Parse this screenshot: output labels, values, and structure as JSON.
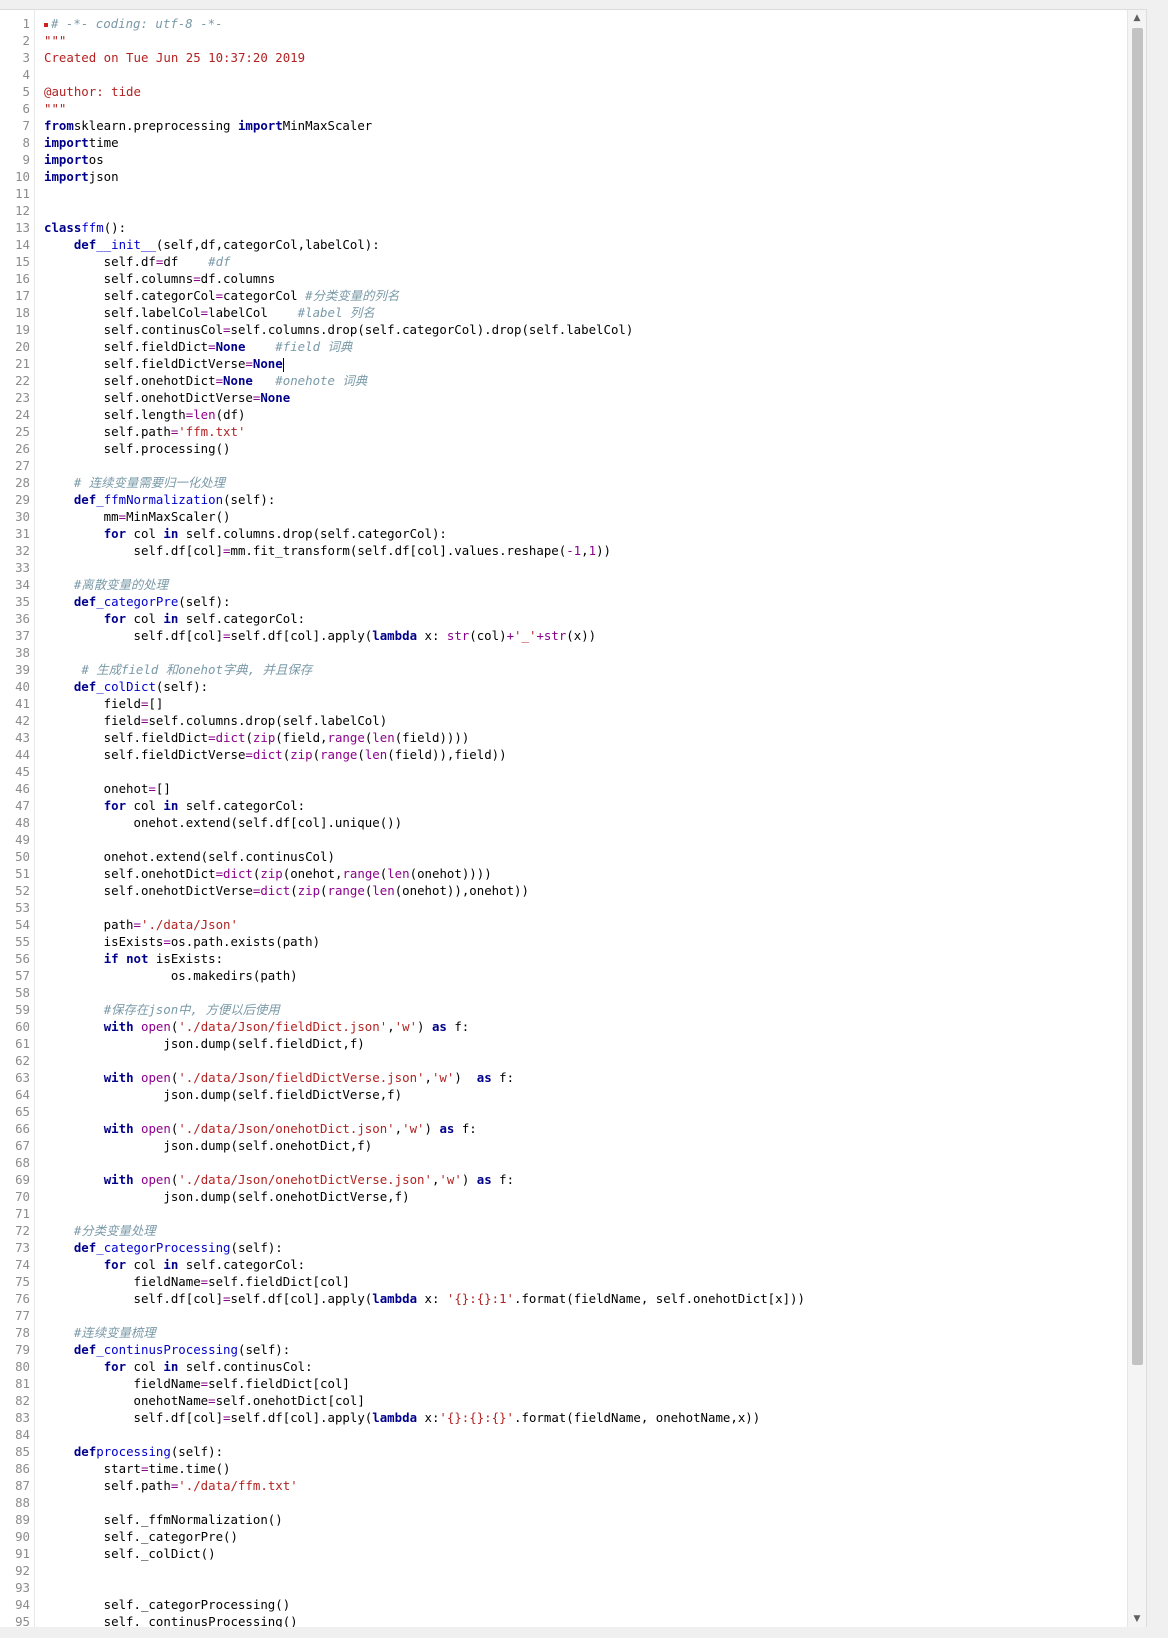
{
  "editor": {
    "language": "python",
    "cursor_line": 21,
    "lines": [
      [
        [
          "marker",
          ""
        ],
        [
          "com",
          "# -*- coding: utf-8 -*-"
        ]
      ],
      [
        [
          "str",
          "\"\"\""
        ]
      ],
      [
        [
          "str",
          "Created on Tue Jun 25 10:37:20 2019"
        ]
      ],
      [],
      [
        [
          "str",
          "@author: tide"
        ]
      ],
      [
        [
          "str",
          "\"\"\""
        ]
      ],
      [
        [
          "kw",
          "from"
        ],
        [
          "",
          "sklearn.preprocessing "
        ],
        [
          "kw",
          "import"
        ],
        [
          "",
          "MinMaxScaler"
        ]
      ],
      [
        [
          "kw",
          "import"
        ],
        [
          "",
          "time"
        ]
      ],
      [
        [
          "kw",
          "import"
        ],
        [
          "",
          "os"
        ]
      ],
      [
        [
          "kw",
          "import"
        ],
        [
          "",
          "json"
        ]
      ],
      [],
      [],
      [
        [
          "kw",
          "class"
        ],
        [
          "fn",
          "ffm"
        ],
        [
          "",
          "():"
        ]
      ],
      [
        [
          "",
          "    "
        ],
        [
          "kw",
          "def"
        ],
        [
          "fn",
          "__init__"
        ],
        [
          "",
          "(self,df,categorCol,labelCol):"
        ]
      ],
      [
        [
          "",
          "        self.df"
        ],
        [
          "op",
          "="
        ],
        [
          "",
          "df    "
        ],
        [
          "com",
          "#df"
        ]
      ],
      [
        [
          "",
          "        self.columns"
        ],
        [
          "op",
          "="
        ],
        [
          "",
          "df.columns"
        ]
      ],
      [
        [
          "",
          "        self.categorCol"
        ],
        [
          "op",
          "="
        ],
        [
          "",
          "categorCol "
        ],
        [
          "com",
          "#分类变量的列名"
        ]
      ],
      [
        [
          "",
          "        self.labelCol"
        ],
        [
          "op",
          "="
        ],
        [
          "",
          "labelCol    "
        ],
        [
          "com",
          "#label 列名"
        ]
      ],
      [
        [
          "",
          "        self.continusCol"
        ],
        [
          "op",
          "="
        ],
        [
          "",
          "self.columns.drop(self.categorCol).drop(self.labelCol)"
        ]
      ],
      [
        [
          "",
          "        self.fieldDict"
        ],
        [
          "op",
          "="
        ],
        [
          "kw",
          "None"
        ],
        [
          "",
          "    "
        ],
        [
          "com",
          "#field 词典"
        ]
      ],
      [
        [
          "",
          "        self.fieldDictVerse"
        ],
        [
          "op",
          "="
        ],
        [
          "kw",
          "None"
        ],
        [
          "caret",
          ""
        ]
      ],
      [
        [
          "",
          "        self.onehotDict"
        ],
        [
          "op",
          "="
        ],
        [
          "kw",
          "None"
        ],
        [
          "",
          "   "
        ],
        [
          "com",
          "#onehote 词典"
        ]
      ],
      [
        [
          "",
          "        self.onehotDictVerse"
        ],
        [
          "op",
          "="
        ],
        [
          "kw",
          "None"
        ]
      ],
      [
        [
          "",
          "        self.length"
        ],
        [
          "op",
          "="
        ],
        [
          "bi",
          "len"
        ],
        [
          "",
          "(df)"
        ]
      ],
      [
        [
          "",
          "        self.path"
        ],
        [
          "op",
          "="
        ],
        [
          "str",
          "'ffm.txt'"
        ]
      ],
      [
        [
          "",
          "        self.processing()"
        ]
      ],
      [],
      [
        [
          "",
          "    "
        ],
        [
          "com",
          "# 连续变量需要归一化处理"
        ]
      ],
      [
        [
          "",
          "    "
        ],
        [
          "kw",
          "def"
        ],
        [
          "fn",
          "_ffmNormalization"
        ],
        [
          "",
          "(self):"
        ]
      ],
      [
        [
          "",
          "        mm"
        ],
        [
          "op",
          "="
        ],
        [
          "",
          "MinMaxScaler()"
        ]
      ],
      [
        [
          "",
          "        "
        ],
        [
          "kw",
          "for"
        ],
        [
          "",
          " col "
        ],
        [
          "kw",
          "in"
        ],
        [
          "",
          " self.columns.drop(self.categorCol):"
        ]
      ],
      [
        [
          "",
          "            self.df[col]"
        ],
        [
          "op",
          "="
        ],
        [
          "",
          "mm.fit_transform(self.df[col].values.reshape("
        ],
        [
          "num",
          "-1"
        ],
        [
          "",
          ","
        ],
        [
          "num",
          "1"
        ],
        [
          "",
          "))"
        ]
      ],
      [],
      [
        [
          "",
          "    "
        ],
        [
          "com",
          "#离散变量的处理"
        ]
      ],
      [
        [
          "",
          "    "
        ],
        [
          "kw",
          "def"
        ],
        [
          "fn",
          "_categorPre"
        ],
        [
          "",
          "(self):"
        ]
      ],
      [
        [
          "",
          "        "
        ],
        [
          "kw",
          "for"
        ],
        [
          "",
          " col "
        ],
        [
          "kw",
          "in"
        ],
        [
          "",
          " self.categorCol:"
        ]
      ],
      [
        [
          "",
          "            self.df[col]"
        ],
        [
          "op",
          "="
        ],
        [
          "",
          "self.df[col].apply("
        ],
        [
          "kw",
          "lambda"
        ],
        [
          "",
          " x: "
        ],
        [
          "bi",
          "str"
        ],
        [
          "",
          "(col)"
        ],
        [
          "op",
          "+"
        ],
        [
          "str",
          "'_'"
        ],
        [
          "op",
          "+"
        ],
        [
          "bi",
          "str"
        ],
        [
          "",
          "(x))"
        ]
      ],
      [],
      [
        [
          "",
          "     "
        ],
        [
          "com",
          "# 生成field 和onehot字典, 并且保存"
        ]
      ],
      [
        [
          "",
          "    "
        ],
        [
          "kw",
          "def"
        ],
        [
          "fn",
          "_colDict"
        ],
        [
          "",
          "(self):"
        ]
      ],
      [
        [
          "",
          "        field"
        ],
        [
          "op",
          "="
        ],
        [
          "",
          "[]"
        ]
      ],
      [
        [
          "",
          "        field"
        ],
        [
          "op",
          "="
        ],
        [
          "",
          "self.columns.drop(self.labelCol)"
        ]
      ],
      [
        [
          "",
          "        self.fieldDict"
        ],
        [
          "op",
          "="
        ],
        [
          "bi",
          "dict"
        ],
        [
          "",
          "("
        ],
        [
          "bi",
          "zip"
        ],
        [
          "",
          "(field,"
        ],
        [
          "bi",
          "range"
        ],
        [
          "",
          "("
        ],
        [
          "bi",
          "len"
        ],
        [
          "",
          "(field))))"
        ]
      ],
      [
        [
          "",
          "        self.fieldDictVerse"
        ],
        [
          "op",
          "="
        ],
        [
          "bi",
          "dict"
        ],
        [
          "",
          "("
        ],
        [
          "bi",
          "zip"
        ],
        [
          "",
          "("
        ],
        [
          "bi",
          "range"
        ],
        [
          "",
          "("
        ],
        [
          "bi",
          "len"
        ],
        [
          "",
          "(field)),field))"
        ]
      ],
      [],
      [
        [
          "",
          "        onehot"
        ],
        [
          "op",
          "="
        ],
        [
          "",
          "[]"
        ]
      ],
      [
        [
          "",
          "        "
        ],
        [
          "kw",
          "for"
        ],
        [
          "",
          " col "
        ],
        [
          "kw",
          "in"
        ],
        [
          "",
          " self.categorCol:"
        ]
      ],
      [
        [
          "",
          "            onehot.extend(self.df[col].unique())"
        ]
      ],
      [],
      [
        [
          "",
          "        onehot.extend(self.continusCol)"
        ]
      ],
      [
        [
          "",
          "        self.onehotDict"
        ],
        [
          "op",
          "="
        ],
        [
          "bi",
          "dict"
        ],
        [
          "",
          "("
        ],
        [
          "bi",
          "zip"
        ],
        [
          "",
          "(onehot,"
        ],
        [
          "bi",
          "range"
        ],
        [
          "",
          "("
        ],
        [
          "bi",
          "len"
        ],
        [
          "",
          "(onehot))))"
        ]
      ],
      [
        [
          "",
          "        self.onehotDictVerse"
        ],
        [
          "op",
          "="
        ],
        [
          "bi",
          "dict"
        ],
        [
          "",
          "("
        ],
        [
          "bi",
          "zip"
        ],
        [
          "",
          "("
        ],
        [
          "bi",
          "range"
        ],
        [
          "",
          "("
        ],
        [
          "bi",
          "len"
        ],
        [
          "",
          "(onehot)),onehot))"
        ]
      ],
      [],
      [
        [
          "",
          "        path"
        ],
        [
          "op",
          "="
        ],
        [
          "str",
          "'./data/Json'"
        ]
      ],
      [
        [
          "",
          "        isExists"
        ],
        [
          "op",
          "="
        ],
        [
          "",
          "os.path.exists(path)"
        ]
      ],
      [
        [
          "",
          "        "
        ],
        [
          "kw",
          "if not"
        ],
        [
          "",
          " isExists:"
        ]
      ],
      [
        [
          "",
          "                 os.makedirs(path)"
        ]
      ],
      [],
      [
        [
          "",
          "        "
        ],
        [
          "com",
          "#保存在json中, 方便以后使用"
        ]
      ],
      [
        [
          "",
          "        "
        ],
        [
          "kw",
          "with"
        ],
        [
          "",
          " "
        ],
        [
          "bi",
          "open"
        ],
        [
          "",
          "("
        ],
        [
          "str",
          "'./data/Json/fieldDict.json'"
        ],
        [
          "",
          ","
        ],
        [
          "str",
          "'w'"
        ],
        [
          "",
          ") "
        ],
        [
          "kw",
          "as"
        ],
        [
          "",
          " f:"
        ]
      ],
      [
        [
          "",
          "                json.dump(self.fieldDict,f)"
        ]
      ],
      [],
      [
        [
          "",
          "        "
        ],
        [
          "kw",
          "with"
        ],
        [
          "",
          " "
        ],
        [
          "bi",
          "open"
        ],
        [
          "",
          "("
        ],
        [
          "str",
          "'./data/Json/fieldDictVerse.json'"
        ],
        [
          "",
          ","
        ],
        [
          "str",
          "'w'"
        ],
        [
          "",
          ")  "
        ],
        [
          "kw",
          "as"
        ],
        [
          "",
          " f:"
        ]
      ],
      [
        [
          "",
          "                json.dump(self.fieldDictVerse,f)"
        ]
      ],
      [],
      [
        [
          "",
          "        "
        ],
        [
          "kw",
          "with"
        ],
        [
          "",
          " "
        ],
        [
          "bi",
          "open"
        ],
        [
          "",
          "("
        ],
        [
          "str",
          "'./data/Json/onehotDict.json'"
        ],
        [
          "",
          ","
        ],
        [
          "str",
          "'w'"
        ],
        [
          "",
          ") "
        ],
        [
          "kw",
          "as"
        ],
        [
          "",
          " f:"
        ]
      ],
      [
        [
          "",
          "                json.dump(self.onehotDict,f)"
        ]
      ],
      [],
      [
        [
          "",
          "        "
        ],
        [
          "kw",
          "with"
        ],
        [
          "",
          " "
        ],
        [
          "bi",
          "open"
        ],
        [
          "",
          "("
        ],
        [
          "str",
          "'./data/Json/onehotDictVerse.json'"
        ],
        [
          "",
          ","
        ],
        [
          "str",
          "'w'"
        ],
        [
          "",
          ") "
        ],
        [
          "kw",
          "as"
        ],
        [
          "",
          " f:"
        ]
      ],
      [
        [
          "",
          "                json.dump(self.onehotDictVerse,f)"
        ]
      ],
      [],
      [
        [
          "",
          "    "
        ],
        [
          "com",
          "#分类变量处理"
        ]
      ],
      [
        [
          "",
          "    "
        ],
        [
          "kw",
          "def"
        ],
        [
          "fn",
          "_categorProcessing"
        ],
        [
          "",
          "(self):"
        ]
      ],
      [
        [
          "",
          "        "
        ],
        [
          "kw",
          "for"
        ],
        [
          "",
          " col "
        ],
        [
          "kw",
          "in"
        ],
        [
          "",
          " self.categorCol:"
        ]
      ],
      [
        [
          "",
          "            fieldName"
        ],
        [
          "op",
          "="
        ],
        [
          "",
          "self.fieldDict[col]"
        ]
      ],
      [
        [
          "",
          "            self.df[col]"
        ],
        [
          "op",
          "="
        ],
        [
          "",
          "self.df[col].apply("
        ],
        [
          "kw",
          "lambda"
        ],
        [
          "",
          " x: "
        ],
        [
          "str",
          "'{}:{}:1'"
        ],
        [
          "",
          ".format(fieldName, self.onehotDict[x]))"
        ]
      ],
      [],
      [
        [
          "",
          "    "
        ],
        [
          "com",
          "#连续变量梳理"
        ]
      ],
      [
        [
          "",
          "    "
        ],
        [
          "kw",
          "def"
        ],
        [
          "fn",
          "_continusProcessing"
        ],
        [
          "",
          "(self):"
        ]
      ],
      [
        [
          "",
          "        "
        ],
        [
          "kw",
          "for"
        ],
        [
          "",
          " col "
        ],
        [
          "kw",
          "in"
        ],
        [
          "",
          " self.continusCol:"
        ]
      ],
      [
        [
          "",
          "            fieldName"
        ],
        [
          "op",
          "="
        ],
        [
          "",
          "self.fieldDict[col]"
        ]
      ],
      [
        [
          "",
          "            onehotName"
        ],
        [
          "op",
          "="
        ],
        [
          "",
          "self.onehotDict[col]"
        ]
      ],
      [
        [
          "",
          "            self.df[col]"
        ],
        [
          "op",
          "="
        ],
        [
          "",
          "self.df[col].apply("
        ],
        [
          "kw",
          "lambda"
        ],
        [
          "",
          " x:"
        ],
        [
          "str",
          "'{}:{}:{}'"
        ],
        [
          "",
          ".format(fieldName, onehotName,x))"
        ]
      ],
      [],
      [
        [
          "",
          "    "
        ],
        [
          "kw",
          "def"
        ],
        [
          "fn",
          "processing"
        ],
        [
          "",
          "(self):"
        ]
      ],
      [
        [
          "",
          "        start"
        ],
        [
          "op",
          "="
        ],
        [
          "",
          "time.time()"
        ]
      ],
      [
        [
          "",
          "        self.path"
        ],
        [
          "op",
          "="
        ],
        [
          "str",
          "'./data/ffm.txt'"
        ]
      ],
      [],
      [
        [
          "",
          "        self._ffmNormalization()"
        ]
      ],
      [
        [
          "",
          "        self._categorPre()"
        ]
      ],
      [
        [
          "",
          "        self._colDict()"
        ]
      ],
      [],
      [],
      [
        [
          "",
          "        self._categorProcessing()"
        ]
      ],
      [
        [
          "",
          "        self._continusProcessing()"
        ]
      ]
    ]
  }
}
